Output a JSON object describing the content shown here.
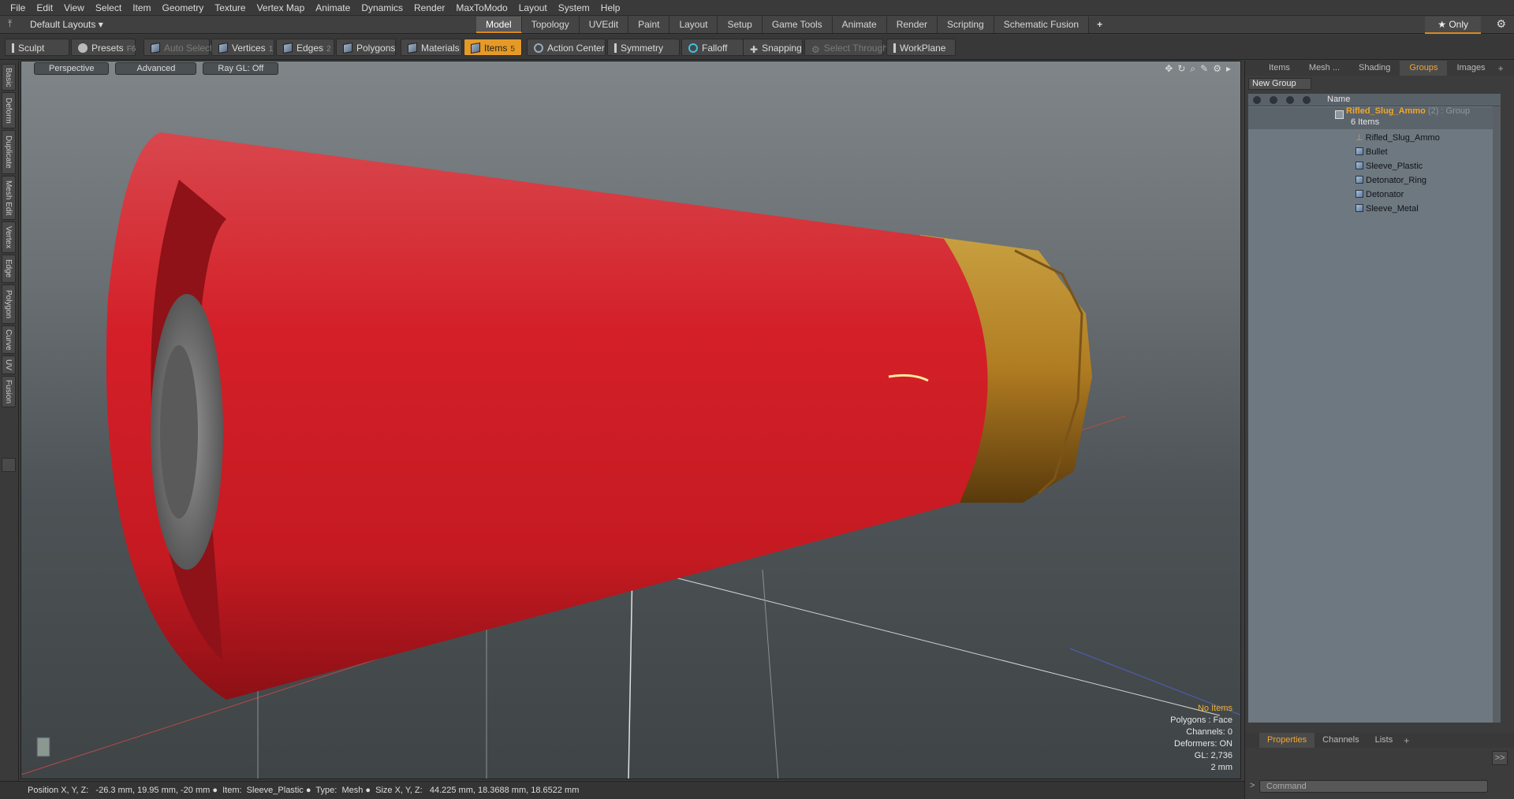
{
  "menu": [
    "File",
    "Edit",
    "View",
    "Select",
    "Item",
    "Geometry",
    "Texture",
    "Vertex Map",
    "Animate",
    "Dynamics",
    "Render",
    "MaxToModo",
    "Layout",
    "System",
    "Help"
  ],
  "layout_selector": "Default Layouts ▾",
  "layout_tabs": [
    "Model",
    "Topology",
    "UVEdit",
    "Paint",
    "Layout",
    "Setup",
    "Game Tools",
    "Animate",
    "Render",
    "Scripting",
    "Schematic Fusion"
  ],
  "only_label": "★ Only",
  "toolbar": {
    "sculpt": "Sculpt",
    "presets": "Presets",
    "presets_key": "F6",
    "auto_select": "Auto Select",
    "vertices": "Vertices",
    "vertices_key": "1",
    "edges": "Edges",
    "edges_key": "2",
    "polygons": "Polygons",
    "materials": "Materials",
    "items": "Items",
    "items_key": "5",
    "action_center": "Action Center",
    "symmetry": "Symmetry",
    "falloff": "Falloff",
    "snapping": "Snapping",
    "select_through": "Select Through",
    "workplane": "WorkPlane"
  },
  "left_tabs": [
    "Basic",
    "Deform",
    "Duplicate",
    "Mesh Edit",
    "Vertex",
    "Edge",
    "Polygon",
    "Curve",
    "UV",
    "Fusion"
  ],
  "viewport": {
    "view": "Perspective",
    "mode": "Advanced",
    "raygl": "Ray GL: Off",
    "info": {
      "items": "No Items",
      "polygons": "Polygons : Face",
      "channels": "Channels: 0",
      "deformers": "Deformers: ON",
      "gl": "GL: 2,736",
      "scale": "2 mm"
    }
  },
  "status": "Position X, Y, Z:   -26.3 mm, 19.95 mm, -20 mm ●  Item:  Sleeve_Plastic ●  Type:  Mesh ●  Size X, Y, Z:   44.225 mm, 18.3688 mm, 18.6522 mm",
  "panel": {
    "tabs": [
      "Items",
      "Mesh ...",
      "Shading",
      "Groups",
      "Images"
    ],
    "new_group": "New Group",
    "col_name": "Name",
    "group": {
      "name": "Rifled_Slug_Ammo",
      "suffix": " (2) : Group",
      "count": "6 Items"
    },
    "children": [
      "Rifled_Slug_Ammo",
      "Bullet",
      "Sleeve_Plastic",
      "Detonator_Ring",
      "Detonator",
      "Sleeve_Metal"
    ]
  },
  "bottom_tabs": [
    "Properties",
    "Channels",
    "Lists"
  ],
  "command_placeholder": "Command",
  "colors": {
    "accent": "#e59a28",
    "shell_red": "#d3202a",
    "brass": "#b8862a"
  }
}
